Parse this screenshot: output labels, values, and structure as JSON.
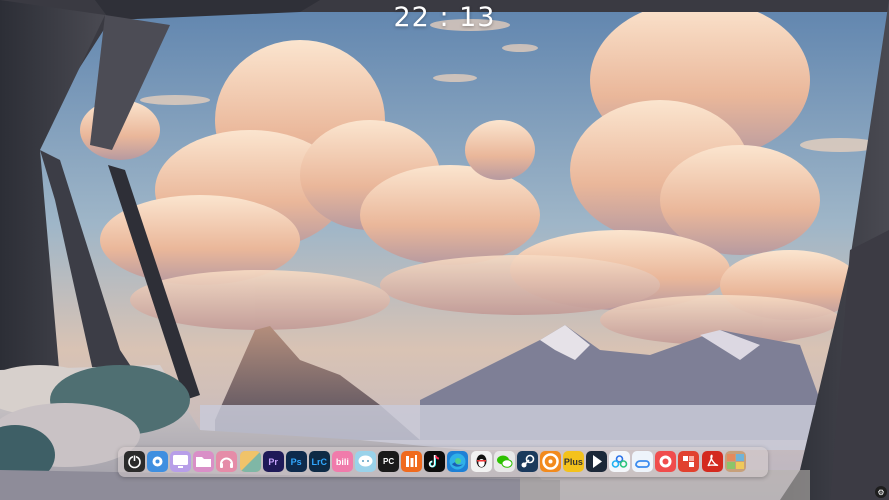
{
  "clock": {
    "time": "22 : 13"
  },
  "wallpaper": {
    "icon": "wallpaper-mountain-clouds-window"
  },
  "dock": {
    "items": [
      {
        "icon": "power-icon",
        "color": "#2b2b2b"
      },
      {
        "icon": "gear-icon",
        "color": "#3f8fe0"
      },
      {
        "icon": "monitor-icon",
        "color": "#b79ee8"
      },
      {
        "icon": "folder-icon",
        "color": "#d98fc7"
      },
      {
        "icon": "headphones-icon",
        "color": "#e58ca8"
      },
      {
        "icon": "gallery-icon",
        "color": "#e6a57a"
      },
      {
        "icon": "premiere-icon",
        "label": "Pr",
        "color": "#1f1a58"
      },
      {
        "icon": "photoshop-icon",
        "label": "Ps",
        "color": "#0d2a4c"
      },
      {
        "icon": "lightroom-classic-icon",
        "label": "LrC",
        "color": "#0e2a45"
      },
      {
        "icon": "bilibili-icon",
        "label": "bili",
        "color": "#f07bab"
      },
      {
        "icon": "chat-bubble-icon",
        "color": "#9ad2ea"
      },
      {
        "icon": "pycharm-icon",
        "label": "PC",
        "color": "#1a1a1a"
      },
      {
        "icon": "orange-bars-icon",
        "color": "#f06a1d"
      },
      {
        "icon": "tiktok-icon",
        "color": "#0c0c0c"
      },
      {
        "icon": "edge-icon",
        "color": "#1d80d6"
      },
      {
        "icon": "qq-penguin-icon",
        "color": "#f2f2f2"
      },
      {
        "icon": "wechat-icon",
        "color": "#e8e8e8"
      },
      {
        "icon": "steam-icon",
        "color": "#1b3a5c"
      },
      {
        "icon": "orange-ring-icon",
        "color": "#f28a1d"
      },
      {
        "icon": "yellow-app-icon",
        "label": "Plus",
        "color": "#f4c21b"
      },
      {
        "icon": "dark-square-icon",
        "color": "#1c2838"
      },
      {
        "icon": "cloud-drive-icon",
        "color": "#f4f7fb"
      },
      {
        "icon": "baidu-netdisk-icon",
        "color": "#eef4fb"
      },
      {
        "icon": "red-circle-icon",
        "color": "#f04c4c"
      },
      {
        "icon": "red-tool-icon",
        "color": "#e1412e"
      },
      {
        "icon": "acrobat-icon",
        "color": "#d42a1f"
      },
      {
        "icon": "photo-collage-icon",
        "color": "#c7a07a"
      }
    ]
  },
  "tray": {
    "icon": "settings-icon"
  }
}
